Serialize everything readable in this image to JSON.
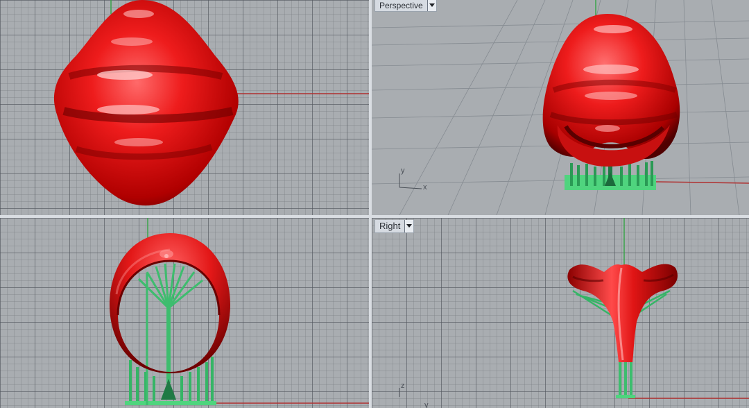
{
  "viewports": {
    "top": {
      "title": ""
    },
    "perspective": {
      "title": "Perspective"
    },
    "front": {
      "title": ""
    },
    "right": {
      "title": "Right"
    }
  },
  "axes": {
    "perspective_x": "x",
    "perspective_y": "y",
    "right_z": "z",
    "right_y": "y"
  },
  "colors": {
    "viewport_bg": "#a9adb1",
    "grid_major": "#5a5f66",
    "model_red": "#e01010",
    "support_green": "#2fb86a",
    "x_axis_line": "#b03030",
    "y_axis_line": "#3aa34a"
  }
}
